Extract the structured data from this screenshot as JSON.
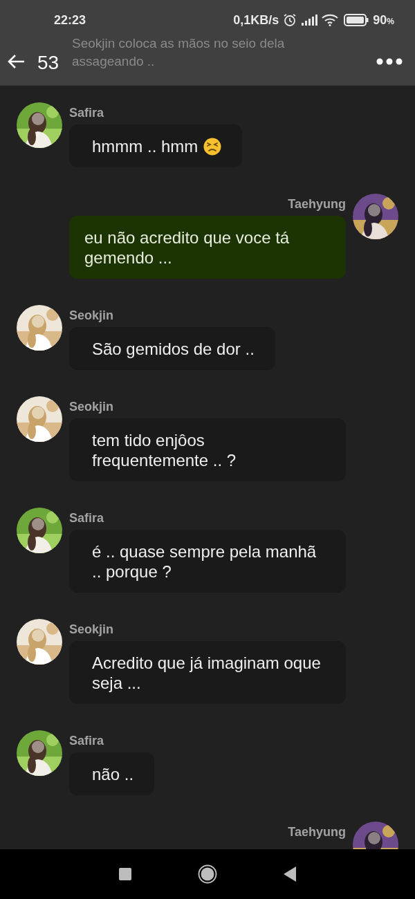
{
  "status_bar": {
    "time": "22:23",
    "speed": "0,1KB/s",
    "battery": "90",
    "battery_unit": "%"
  },
  "header": {
    "faded_lines": [
      "Seokjin coloca as mãos no seio dela",
      "assageando .."
    ],
    "title": "53"
  },
  "messages": [
    {
      "kind": "received",
      "name": "Safira",
      "text": "hmmm .. hmm",
      "emoji": true
    },
    {
      "kind": "sent",
      "name": "Taehyung",
      "text": "eu não acredito que voce tá gemendo ..."
    },
    {
      "kind": "received",
      "name": "Seokjin",
      "text": "São gemidos de dor .."
    },
    {
      "kind": "received",
      "name": "Seokjin",
      "text": "tem tido enjôos frequentemente .. ?"
    },
    {
      "kind": "received",
      "name": "Safira",
      "text": "é .. quase sempre pela manhã .. porque ?"
    },
    {
      "kind": "received",
      "name": "Seokjin",
      "text": "Acredito que já imaginam oque seja ..."
    },
    {
      "kind": "received",
      "name": "Safira",
      "text": "não .."
    },
    {
      "kind": "sent",
      "name": "Taehyung"
    }
  ]
}
